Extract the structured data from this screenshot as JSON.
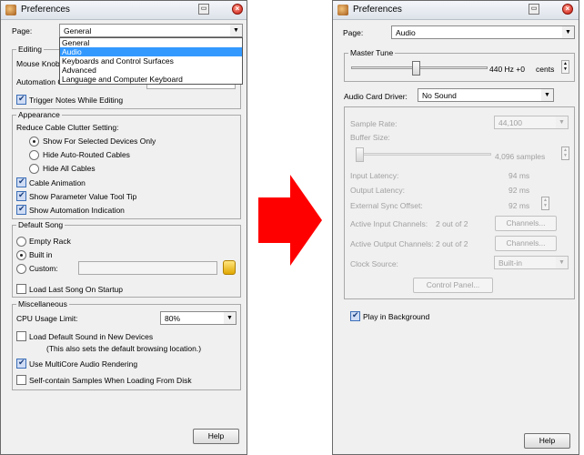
{
  "left": {
    "title": "Preferences",
    "page_label": "Page:",
    "page_value": "General",
    "dropdown": [
      "General",
      "Audio",
      "Keyboards and Control Surfaces",
      "Advanced",
      "Language and Computer Keyboard"
    ],
    "dropdown_selected": 1,
    "editing": {
      "title": "Editing",
      "mouse_knob_label": "Mouse Knob",
      "automation_label": "Automation C",
      "trigger_label": "Trigger Notes While Editing"
    },
    "appearance": {
      "title": "Appearance",
      "reduce_label": "Reduce Cable Clutter Setting:",
      "radio_show": "Show For Selected Devices Only",
      "radio_hide_auto": "Hide Auto-Routed Cables",
      "radio_hide_all": "Hide All Cables",
      "cable_anim": "Cable Animation",
      "param_tip": "Show Parameter Value Tool Tip",
      "automation_ind": "Show Automation Indication"
    },
    "default_song": {
      "title": "Default Song",
      "empty_rack": "Empty Rack",
      "built_in": "Built in",
      "custom": "Custom:",
      "load_last": "Load Last Song On Startup"
    },
    "misc": {
      "title": "Miscellaneous",
      "cpu_label": "CPU Usage Limit:",
      "cpu_value": "80%",
      "load_default": "Load Default Sound in New Devices",
      "load_default_note": "(This also sets the default browsing location.)",
      "multicore": "Use MultiCore Audio Rendering",
      "self_contain": "Self-contain Samples When Loading From Disk"
    },
    "help": "Help"
  },
  "right": {
    "title": "Preferences",
    "page_label": "Page:",
    "page_value": "Audio",
    "master_tune": {
      "title": "Master Tune",
      "value": "440 Hz +0",
      "unit": "cents"
    },
    "card_driver_label": "Audio Card Driver:",
    "card_driver_value": "No Sound",
    "sample_rate_label": "Sample Rate:",
    "sample_rate_value": "44,100",
    "buffer_label": "Buffer Size:",
    "buffer_value": "4,096 samples",
    "input_latency_label": "Input Latency:",
    "input_latency_value": "94 ms",
    "output_latency_label": "Output Latency:",
    "output_latency_value": "92 ms",
    "ext_sync_label": "External Sync Offset:",
    "ext_sync_value": "92 ms",
    "active_in_label": "Active Input Channels:",
    "active_in_value": "2 out of 2",
    "active_out_label": "Active Output Channels:",
    "active_out_value": "2 out of 2",
    "channels_btn": "Channels...",
    "clock_label": "Clock Source:",
    "clock_value": "Built-in",
    "control_panel": "Control Panel...",
    "play_bg": "Play in Background",
    "help": "Help"
  }
}
